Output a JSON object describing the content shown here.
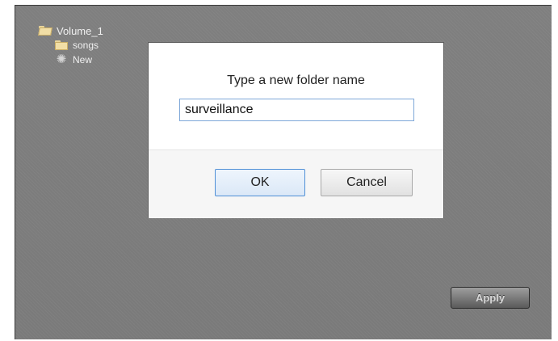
{
  "tree": {
    "root_label": "Volume_1",
    "items": [
      {
        "label": "songs",
        "icon": "folder-icon"
      },
      {
        "label": "New",
        "icon": "loading-spinner-icon"
      }
    ],
    "root_icon": "folder-open-icon"
  },
  "dialog": {
    "title": "Type a new folder name",
    "input_value": "surveillance",
    "ok_label": "OK",
    "cancel_label": "Cancel"
  },
  "apply_label": "Apply",
  "colors": {
    "backdrop": "#7e7e7e",
    "input_border": "#7ea7d8",
    "ok_border": "#4f8fd6"
  }
}
